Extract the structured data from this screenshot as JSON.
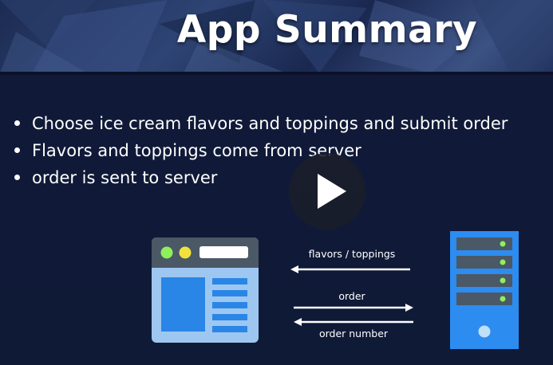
{
  "slide": {
    "title": "App Summary",
    "bullets": [
      "Choose ice cream flavors and toppings and submit order",
      "Flavors and toppings come from server",
      "order is sent to server"
    ]
  },
  "diagram": {
    "arrows": [
      {
        "label": "flavors / toppings",
        "direction": "left"
      },
      {
        "label": "order",
        "direction": "right"
      },
      {
        "label": "order number",
        "direction": "left"
      }
    ]
  },
  "player": {
    "play_icon": "play-icon"
  },
  "colors": {
    "background": "#0f1a37",
    "browser_blue": "#9dc7f0",
    "browser_dark": "#4b5866",
    "server_blue": "#2d8cf0",
    "indicator_green": "#8ef05a",
    "dot_yellow": "#f2e23e"
  }
}
